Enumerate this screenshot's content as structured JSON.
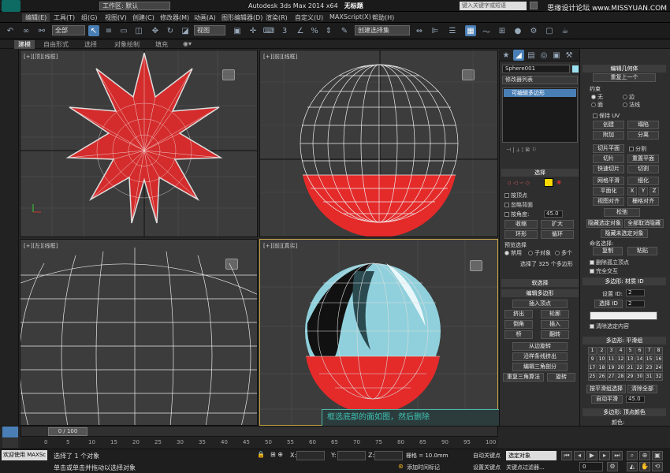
{
  "titlebar": {
    "workspace": "工作区: 默认",
    "app": "Autodesk 3ds Max  2014 x64",
    "doc": "无标题",
    "search_placeholder": "键入关键字或短语",
    "watermark": "思缘设计论坛 www.MISSYUAN.COM"
  },
  "menu": [
    "编辑(E)",
    "工具(T)",
    "组(G)",
    "视图(V)",
    "创建(C)",
    "修改器(M)",
    "动画(A)",
    "图形编辑器(D)",
    "渲染(R)",
    "自定义(U)",
    "MAXScript(X)",
    "帮助(H)"
  ],
  "toolbar": {
    "filter": "全部",
    "coord": "视图",
    "selset": "创建选择集"
  },
  "ribbon": {
    "tabs": [
      "建模",
      "自由形式",
      "选择",
      "对象绘制",
      "填充"
    ]
  },
  "viewports": {
    "top": {
      "label": "[+][顶][线框]"
    },
    "front": {
      "label": "[+][前][线框]"
    },
    "left": {
      "label": "[+][左][线框]"
    },
    "persp": {
      "label": "[+][前][真实]"
    }
  },
  "annotation": "框选底部的面如图，然后删除",
  "cmd": {
    "object_name": "Sphere001",
    "modifier_list": "修改器列表",
    "stack_item": "可编辑多边形",
    "selection": {
      "title": "选择",
      "by_vertex": "按顶点",
      "ignore_back": "忽略背面",
      "by_angle": "按角度:",
      "angle": "45.0",
      "shrink": "收缩",
      "grow": "扩大",
      "ring": "环形",
      "loop": "循环",
      "preview": "预览选择",
      "disabled": "禁用",
      "subobj": "子对象",
      "multi": "多个",
      "status": "选择了 325 个多边形"
    },
    "soft_select": "软选择",
    "edit_poly": {
      "title": "编辑多边形",
      "insert_vertex": "插入顶点",
      "extrude": "挤出",
      "outline": "轮廓",
      "bevel": "倒角",
      "inset": "插入",
      "bridge": "桥",
      "flip": "翻转",
      "hinge": "从边旋转",
      "along_spline": "沿样条线挤出",
      "edit_tri": "编辑三角剖分",
      "retri": "重复三角算法",
      "turn": "旋转"
    }
  },
  "right": {
    "edit_geom": "编辑几何体",
    "repeat_last": "重复上一个",
    "constraint": "约束",
    "none": "无",
    "edge": "边",
    "face": "面",
    "normal": "法线",
    "keep_uv": "保持 UV",
    "create": "创建",
    "collapse": "塌陷",
    "attach": "附加",
    "detach": "分离",
    "slice_plane": "切片平面",
    "split": "分割",
    "slice": "切片",
    "reset_plane": "重置平面",
    "quickslice": "快速切片",
    "cut": "切割",
    "meshsmooth": "网格平滑",
    "tessellate": "细化",
    "make_planar": "平面化",
    "x": "X",
    "y": "Y",
    "z": "Z",
    "view_align": "视图对齐",
    "grid_align": "栅格对齐",
    "relax": "松弛",
    "hide_sel": "隐藏选定对象",
    "unhide_all": "全部取消隐藏",
    "hide_unsel": "隐藏未选定对象",
    "named_sel": "命名选择:",
    "copy": "复制",
    "paste": "粘贴",
    "delete_iso": "删除孤立顶点",
    "full_interact": "完全交互",
    "matid": "多边形: 材质 ID",
    "set_id": "设置 ID:",
    "sel_id": "选择 ID",
    "id_val": "2",
    "clear_sel": "清除选定内容",
    "smooth_groups": "多边形: 平滑组",
    "sg": [
      "1",
      "2",
      "3",
      "4",
      "5",
      "6",
      "7",
      "8",
      "9",
      "10",
      "11",
      "12",
      "13",
      "14",
      "15",
      "16",
      "17",
      "18",
      "19",
      "20",
      "21",
      "22",
      "23",
      "24",
      "25",
      "26",
      "27",
      "28",
      "29",
      "30",
      "31",
      "32"
    ],
    "sel_by_sg": "按平滑组选择",
    "clear_all": "清除全部",
    "auto_smooth": "自动平滑",
    "smooth_val": "45.0",
    "vertex_colors": "多边形: 顶点颜色",
    "color": "颜色:",
    "illum": "照明:",
    "alpha": "Alpha:",
    "alpha_val": "100.0"
  },
  "timeline": {
    "slider": "0 / 100",
    "ticks": [
      "0",
      "5",
      "10",
      "15",
      "20",
      "25",
      "30",
      "35",
      "40",
      "45",
      "50",
      "55",
      "60",
      "65",
      "70",
      "75",
      "80",
      "85",
      "90",
      "95",
      "100"
    ]
  },
  "status": {
    "listener": "欢迎使用 MAXSc",
    "selected": "选择了 1 个对象",
    "hint": "单击或单击并拖动以选择对象",
    "x": "X:",
    "y": "Y:",
    "z": "Z:",
    "grid": "栅格 = 10.0mm",
    "autokey": "自动关键点",
    "selected_set": "选定对象",
    "setkey": "设置关键点",
    "keyfilter": "关键点过滤器...",
    "addtime": "添加时间标记",
    "frame": "0"
  }
}
